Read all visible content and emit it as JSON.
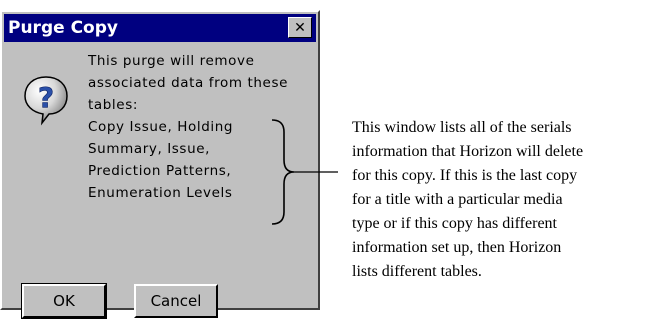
{
  "dialog": {
    "title": "Purge Copy",
    "close_glyph": "✕",
    "icon": "question-icon",
    "message_lines": [
      "This purge will remove",
      "associated data from these",
      "tables:",
      "Copy Issue, Holding",
      "Summary, Issue,",
      "Prediction Patterns,",
      "Enumeration Levels"
    ],
    "ok_label": "OK",
    "cancel_label": "Cancel"
  },
  "callout": {
    "lines": [
      "This window lists all of the serials",
      "information that Horizon will delete",
      "for this copy. If this is the last copy",
      "for a title with a particular media",
      "type or if this copy has different",
      "information set up, then Horizon",
      "lists different tables."
    ]
  },
  "colors": {
    "titlebar": "#000080",
    "window_face": "#c0c0c0",
    "icon_fill": "#2a4fa8"
  }
}
